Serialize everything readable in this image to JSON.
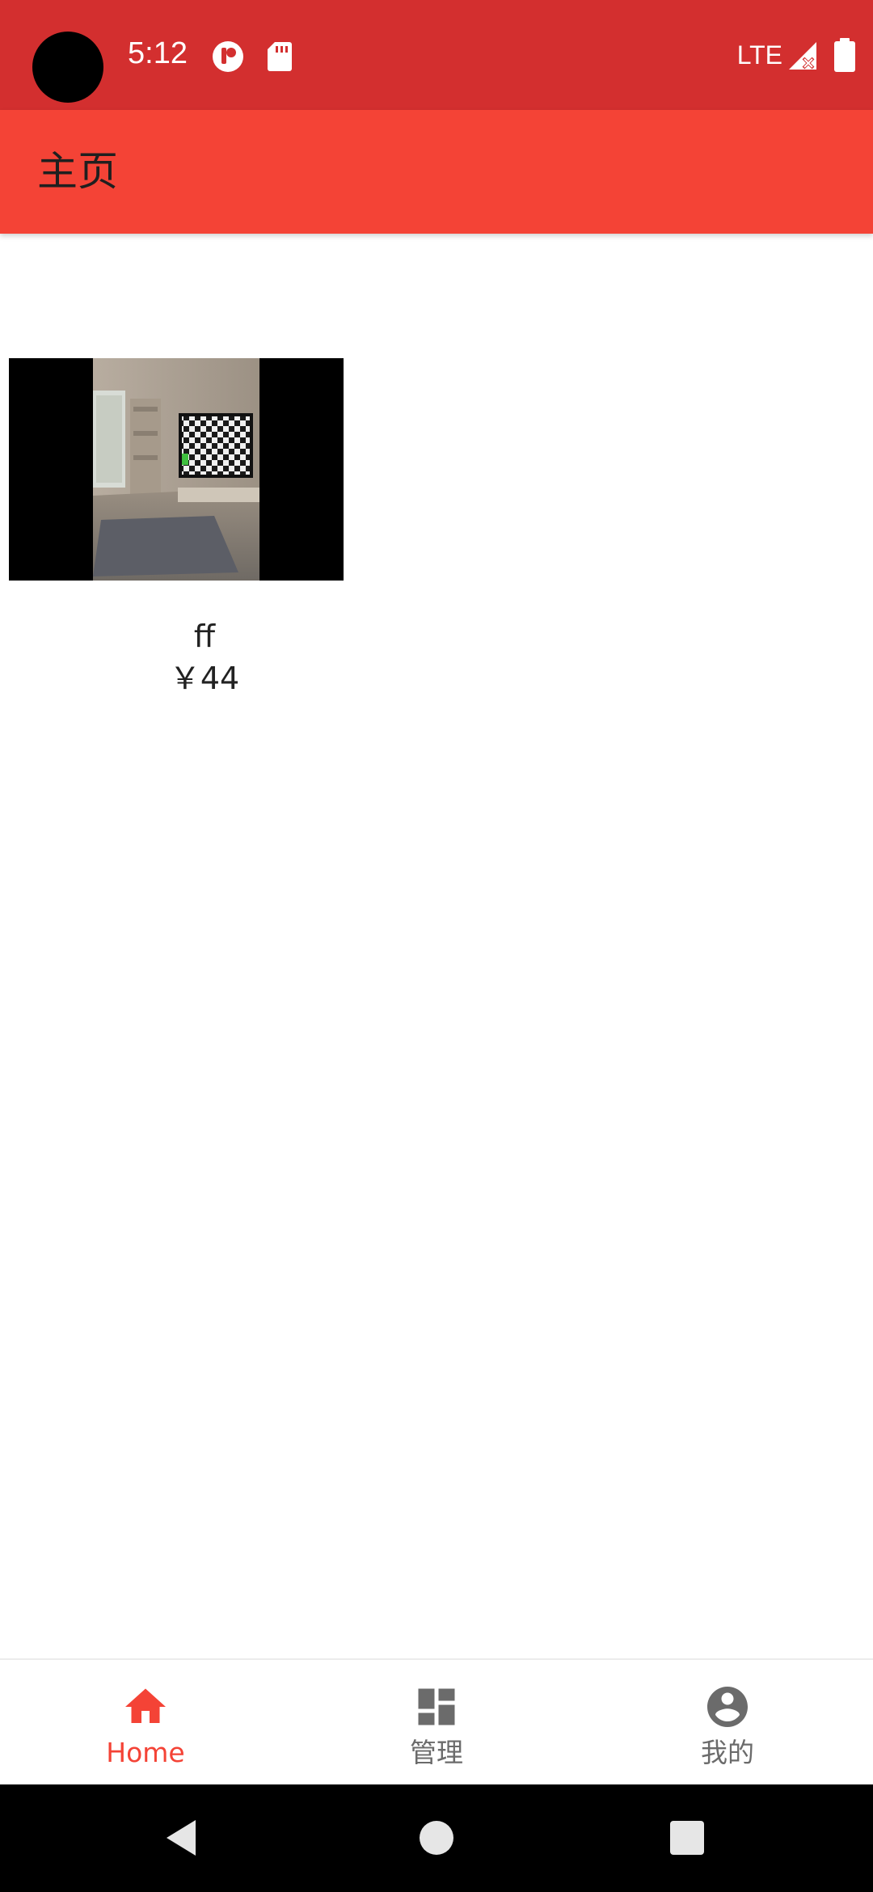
{
  "status_bar": {
    "time": "5:12",
    "network": "LTE",
    "icons": [
      "notification-app-icon",
      "sd-card-icon",
      "signal-no-data-icon",
      "battery-icon"
    ],
    "background_color": "#d32f2f"
  },
  "toolbar": {
    "title": "主页",
    "background_color": "#f44336"
  },
  "products": [
    {
      "name": "ff",
      "price": "￥44",
      "image": "living-room-tv-photo"
    }
  ],
  "bottom_nav": {
    "active_color": "#f44336",
    "inactive_color": "#6b6b6b",
    "items": [
      {
        "label": "Home",
        "icon": "home-icon",
        "active": true
      },
      {
        "label": "管理",
        "icon": "dashboard-icon",
        "active": false
      },
      {
        "label": "我的",
        "icon": "account-circle-icon",
        "active": false
      }
    ]
  },
  "system_nav": {
    "buttons": [
      "back-icon",
      "home-circle-icon",
      "recents-icon"
    ]
  }
}
